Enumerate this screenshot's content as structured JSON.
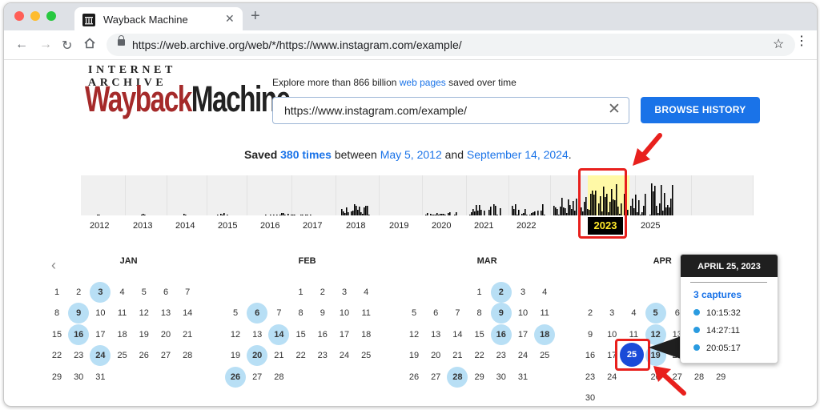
{
  "browser": {
    "tab_title": "Wayback Machine",
    "tab_close": "✕",
    "new_tab": "+",
    "url": "https://web.archive.org/web/*/https://www.instagram.com/example/"
  },
  "logo": {
    "top": "INTERNET ARCHIVE",
    "main_left": "Wayback",
    "main_right": "Machine"
  },
  "explore": {
    "prefix": "Explore more than 866 billion ",
    "link": "web pages",
    "suffix": " saved over time"
  },
  "search": {
    "value": "https://www.instagram.com/example/",
    "clear": "✕",
    "button": "BROWSE HISTORY"
  },
  "saved": {
    "prefix": "Saved ",
    "count": "380 times",
    "between": " between ",
    "start": "May 5, 2012",
    "and": " and ",
    "end": "September 14, 2024",
    "period": "."
  },
  "timeline": {
    "years": [
      "2012",
      "2013",
      "2014",
      "2015",
      "2016",
      "2017",
      "2018",
      "2019",
      "2020",
      "2021",
      "2022",
      "2023",
      "2025"
    ],
    "selected_year": "2023",
    "highlight_color": "#fff9a6",
    "bar_color": "#000000"
  },
  "calendar": {
    "prev_icon": "‹",
    "months": [
      {
        "name": "JAN",
        "offset": 0,
        "days": 31,
        "captures": [
          3,
          9,
          16,
          24
        ]
      },
      {
        "name": "FEB",
        "offset": 3,
        "days": 28,
        "captures": [
          6,
          14,
          20,
          26
        ]
      },
      {
        "name": "MAR",
        "offset": 3,
        "days": 31,
        "captures": [
          2,
          9,
          16,
          18,
          28
        ]
      },
      {
        "name": "APR",
        "offset": 6,
        "days": 30,
        "captures": [
          5,
          12,
          19,
          25
        ]
      }
    ],
    "selected_day": "25"
  },
  "popup": {
    "date": "APRIL 25, 2023",
    "captures_label": "3 captures",
    "times": [
      "10:15:32",
      "14:27:11",
      "20:05:17"
    ]
  },
  "colors": {
    "accent": "#1a73e8",
    "capture_bubble": "#b8dff5",
    "selected": "#1a4bd8",
    "annotation_red": "#e8201d"
  }
}
